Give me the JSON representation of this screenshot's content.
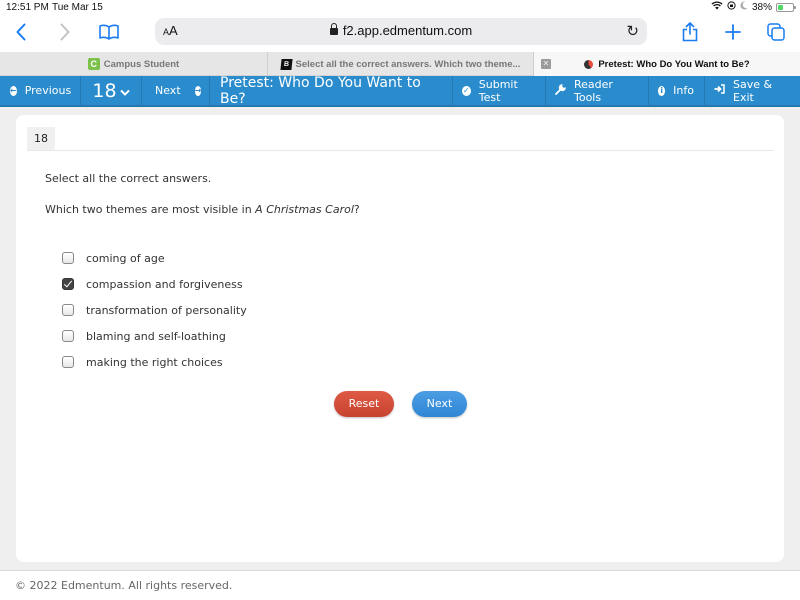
{
  "status_bar": {
    "time": "12:51 PM",
    "date": "Tue Mar 15",
    "battery_text": "38%",
    "battery_level": 0.38,
    "icons": [
      "wifi-icon",
      "orientation-lock-icon",
      "moon-icon",
      "battery-charging-icon"
    ]
  },
  "browser": {
    "aa_label": "AA",
    "url": "f2.app.edmentum.com",
    "tabs": [
      {
        "label": "Campus Student",
        "favicon": "C",
        "active": false
      },
      {
        "label": "Select all the correct answers. Which two theme...",
        "favicon": "B",
        "active": false
      },
      {
        "label": "Pretest: Who Do You Want to Be?",
        "favicon": "edmentum",
        "active": true
      }
    ]
  },
  "nav": {
    "previous_label": "Previous",
    "question_number": "18",
    "next_label": "Next",
    "title": "Pretest: Who Do You Want to Be?",
    "submit_label": "Submit Test",
    "reader_tools_label": "Reader Tools",
    "info_label": "Info",
    "save_exit_label": "Save & Exit",
    "color": "#2b8ccd"
  },
  "question": {
    "number": "18",
    "instruction": "Select all the correct answers.",
    "prompt_before": "Which two themes are most visible in ",
    "prompt_title": "A Christmas Carol",
    "prompt_after": "?",
    "options": [
      {
        "label": "coming of age",
        "checked": false
      },
      {
        "label": "compassion and forgiveness",
        "checked": true
      },
      {
        "label": "transformation of personality",
        "checked": false
      },
      {
        "label": "blaming and self-loathing",
        "checked": false
      },
      {
        "label": "making the right choices",
        "checked": false
      }
    ]
  },
  "buttons": {
    "reset_label": "Reset",
    "next_label": "Next",
    "reset_color": "#d24f3b",
    "next_color": "#3b8fd9"
  },
  "footer": {
    "copyright": "© 2022 Edmentum. All rights reserved."
  }
}
